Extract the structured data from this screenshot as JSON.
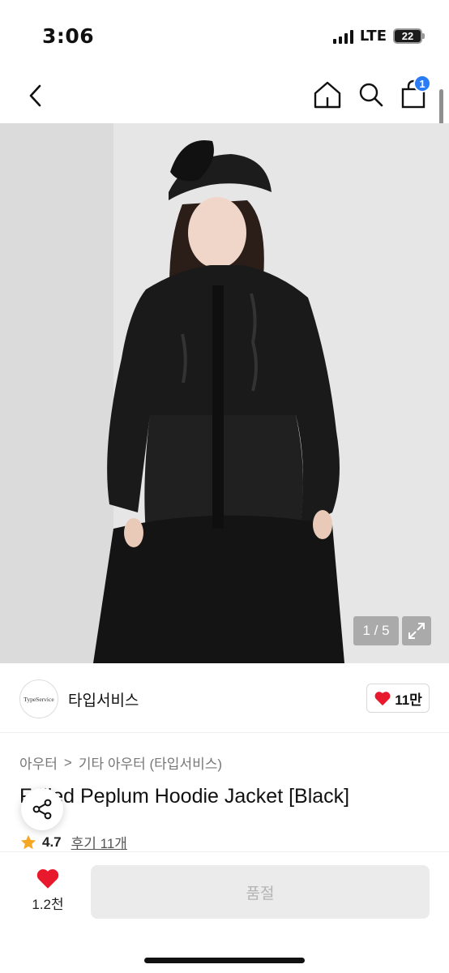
{
  "status_bar": {
    "time": "3:06",
    "network": "LTE",
    "battery": "22"
  },
  "nav": {
    "cart_count": "1"
  },
  "image": {
    "counter": "1 / 5"
  },
  "brand": {
    "logo_text": "TypeService",
    "name": "타입서비스",
    "like_count": "11만"
  },
  "breadcrumb": {
    "category": "아우터",
    "separator": ">",
    "subcategory": "기타 아우터 (타입서비스)"
  },
  "product": {
    "title": "Frilled Peplum Hoodie Jacket [Black]",
    "rating": "4.7",
    "reviews": "후기 11개"
  },
  "bottom_bar": {
    "wish_count": "1.2천",
    "buy_label": "품절"
  },
  "colors": {
    "accent_badge": "#2a7bf6",
    "heart": "#e8192c",
    "star": "#f5a623",
    "disabled_button": "#ebebeb"
  }
}
